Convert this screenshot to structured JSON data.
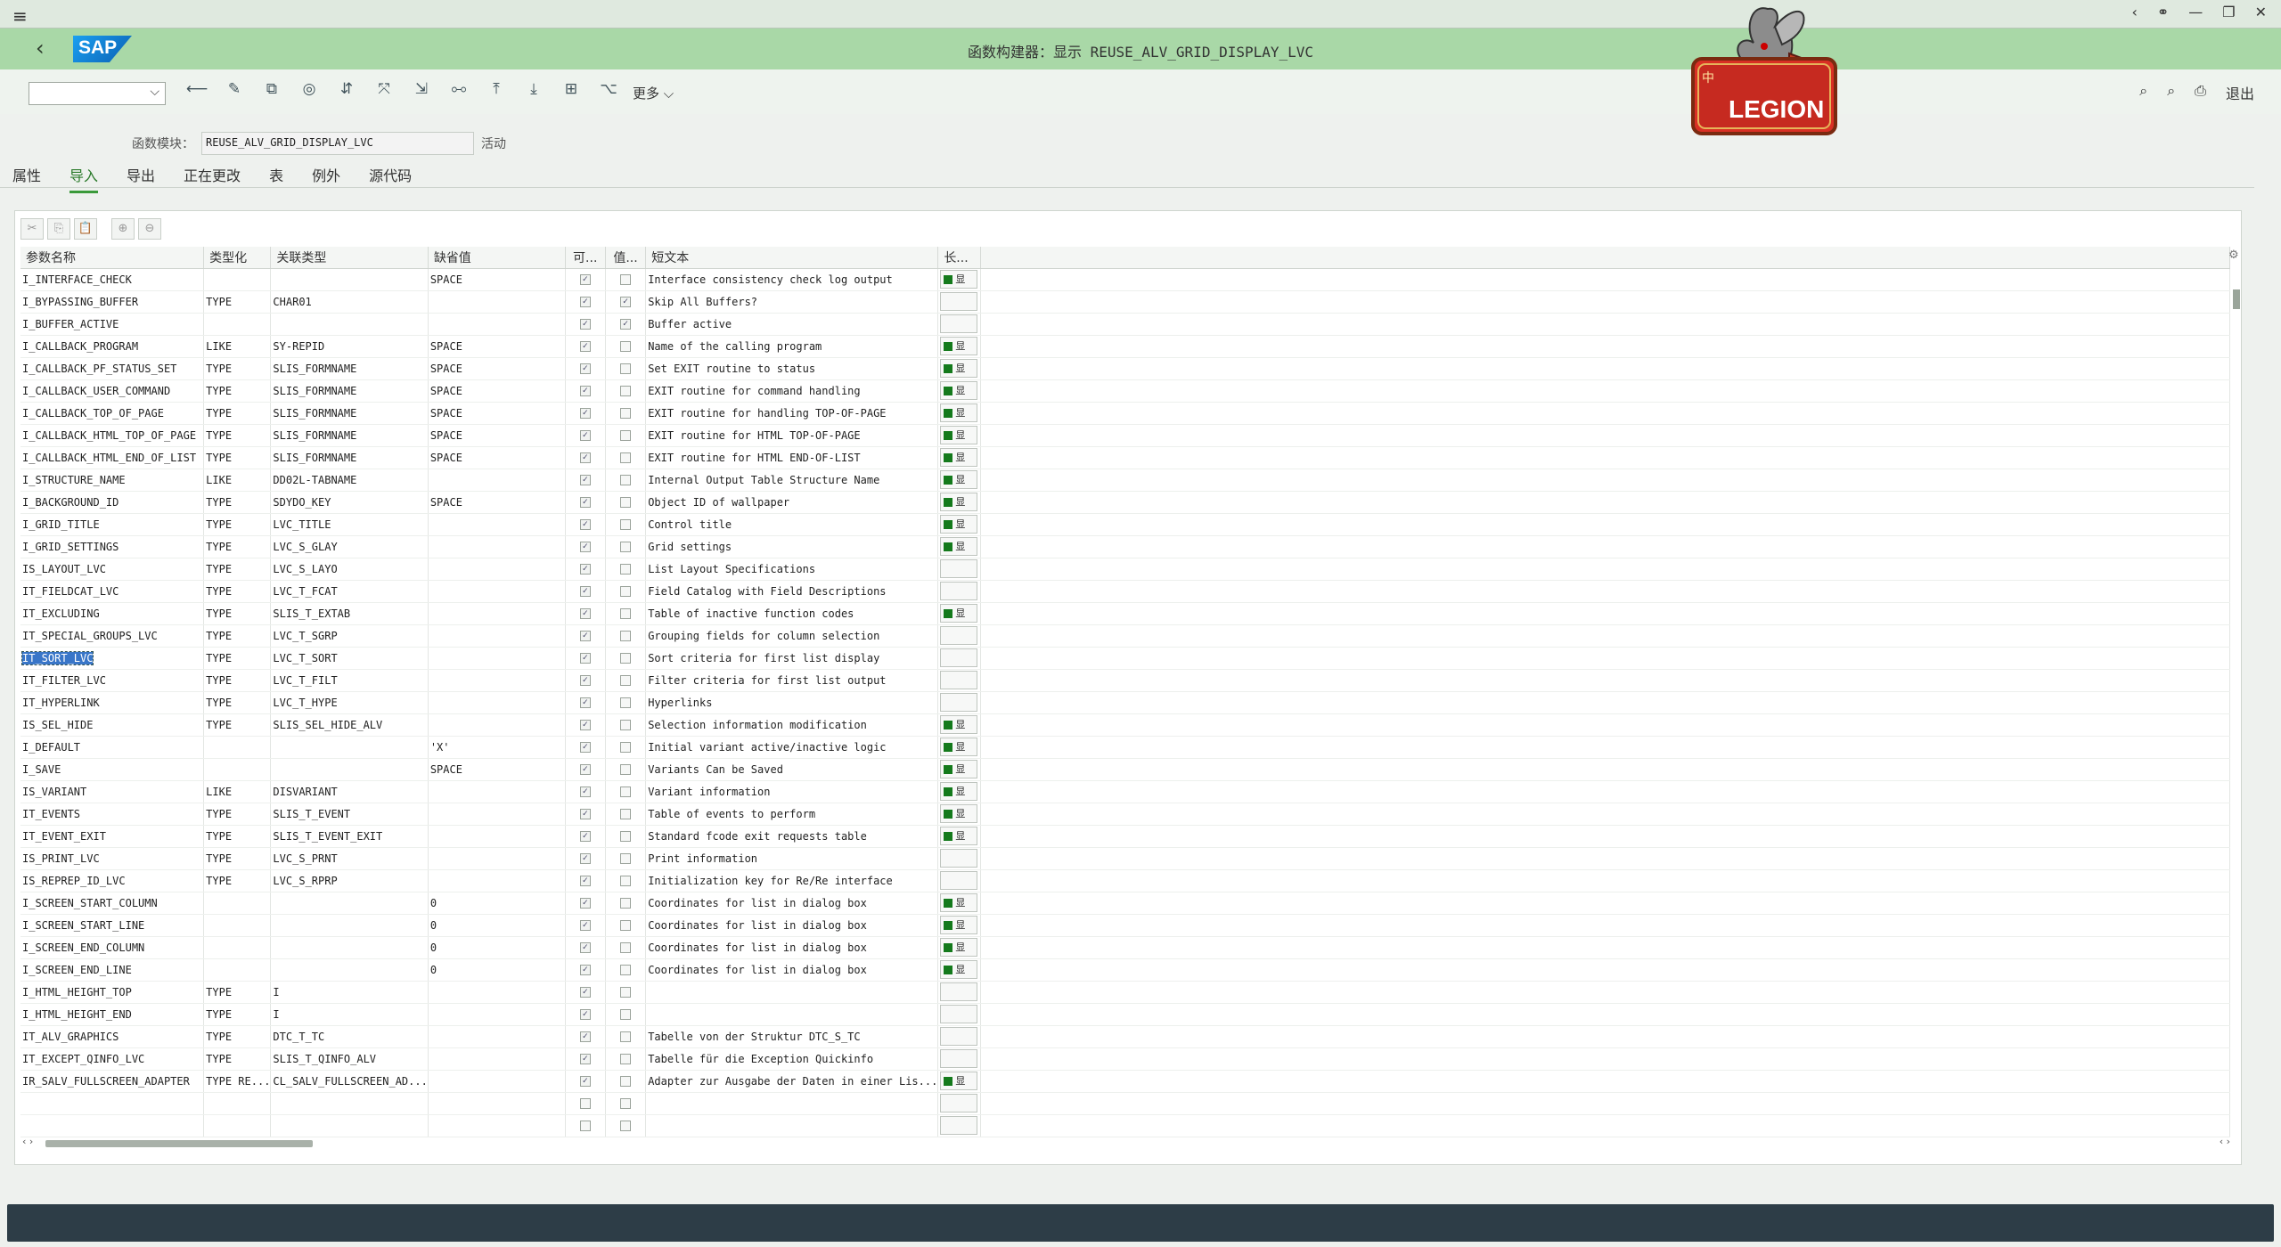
{
  "window": {
    "title": "函数构建器：显示 REUSE_ALV_GRID_DISPLAY_LVC",
    "logo": "SAP"
  },
  "toolbar": {
    "more": "更多",
    "exit": "退出",
    "brand": "LEGION",
    "brand_badge": "中"
  },
  "module": {
    "label": "函数模块：",
    "value": "REUSE_ALV_GRID_DISPLAY_LVC",
    "status": "活动"
  },
  "tabs": [
    {
      "label": "属性",
      "active": false
    },
    {
      "label": "导入",
      "active": true
    },
    {
      "label": "导出",
      "active": false
    },
    {
      "label": "正在更改",
      "active": false
    },
    {
      "label": "表",
      "active": false
    },
    {
      "label": "例外",
      "active": false
    },
    {
      "label": "源代码",
      "active": false
    }
  ],
  "columns": [
    "参数名称",
    "类型化",
    "关联类型",
    "缺省值",
    "可...",
    "值...",
    "短文本",
    "长..."
  ],
  "long_label": "显",
  "rows": [
    [
      "I_INTERFACE_CHECK",
      "",
      "",
      "SPACE",
      true,
      false,
      "Interface consistency check log output",
      true
    ],
    [
      "I_BYPASSING_BUFFER",
      "TYPE",
      "CHAR01",
      "",
      true,
      true,
      "Skip All Buffers?",
      false
    ],
    [
      "I_BUFFER_ACTIVE",
      "",
      "",
      "",
      true,
      true,
      "Buffer active",
      false
    ],
    [
      "I_CALLBACK_PROGRAM",
      "LIKE",
      "SY-REPID",
      "SPACE",
      true,
      false,
      "Name of the calling program",
      true
    ],
    [
      "I_CALLBACK_PF_STATUS_SET",
      "TYPE",
      "SLIS_FORMNAME",
      "SPACE",
      true,
      false,
      "Set EXIT routine to status",
      true
    ],
    [
      "I_CALLBACK_USER_COMMAND",
      "TYPE",
      "SLIS_FORMNAME",
      "SPACE",
      true,
      false,
      "EXIT routine for command handling",
      true
    ],
    [
      "I_CALLBACK_TOP_OF_PAGE",
      "TYPE",
      "SLIS_FORMNAME",
      "SPACE",
      true,
      false,
      "EXIT routine for handling TOP-OF-PAGE",
      true
    ],
    [
      "I_CALLBACK_HTML_TOP_OF_PAGE",
      "TYPE",
      "SLIS_FORMNAME",
      "SPACE",
      true,
      false,
      "EXIT routine for HTML TOP-OF-PAGE",
      true
    ],
    [
      "I_CALLBACK_HTML_END_OF_LIST",
      "TYPE",
      "SLIS_FORMNAME",
      "SPACE",
      true,
      false,
      "EXIT routine for HTML END-OF-LIST",
      true
    ],
    [
      "I_STRUCTURE_NAME",
      "LIKE",
      "DD02L-TABNAME",
      "",
      true,
      false,
      "Internal Output Table Structure Name",
      true
    ],
    [
      "I_BACKGROUND_ID",
      "TYPE",
      "SDYDO_KEY",
      "SPACE",
      true,
      false,
      "Object ID of wallpaper",
      true
    ],
    [
      "I_GRID_TITLE",
      "TYPE",
      "LVC_TITLE",
      "",
      true,
      false,
      "Control title",
      true
    ],
    [
      "I_GRID_SETTINGS",
      "TYPE",
      "LVC_S_GLAY",
      "",
      true,
      false,
      "Grid settings",
      true
    ],
    [
      "IS_LAYOUT_LVC",
      "TYPE",
      "LVC_S_LAYO",
      "",
      true,
      false,
      "List Layout Specifications",
      false
    ],
    [
      "IT_FIELDCAT_LVC",
      "TYPE",
      "LVC_T_FCAT",
      "",
      true,
      false,
      "Field Catalog with Field Descriptions",
      false
    ],
    [
      "IT_EXCLUDING",
      "TYPE",
      "SLIS_T_EXTAB",
      "",
      true,
      false,
      "Table of inactive function codes",
      true
    ],
    [
      "IT_SPECIAL_GROUPS_LVC",
      "TYPE",
      "LVC_T_SGRP",
      "",
      true,
      false,
      "Grouping fields for column selection",
      false
    ],
    [
      "IT_SORT_LVC",
      "TYPE",
      "LVC_T_SORT",
      "",
      true,
      false,
      "Sort criteria for first list display",
      false
    ],
    [
      "IT_FILTER_LVC",
      "TYPE",
      "LVC_T_FILT",
      "",
      true,
      false,
      "Filter criteria for first list output",
      false
    ],
    [
      "IT_HYPERLINK",
      "TYPE",
      "LVC_T_HYPE",
      "",
      true,
      false,
      "Hyperlinks",
      false
    ],
    [
      "IS_SEL_HIDE",
      "TYPE",
      "SLIS_SEL_HIDE_ALV",
      "",
      true,
      false,
      "Selection information modification",
      true
    ],
    [
      "I_DEFAULT",
      "",
      "",
      "'X'",
      true,
      false,
      "Initial variant active/inactive logic",
      true
    ],
    [
      "I_SAVE",
      "",
      "",
      "SPACE",
      true,
      false,
      "Variants Can be Saved",
      true
    ],
    [
      "IS_VARIANT",
      "LIKE",
      "DISVARIANT",
      "",
      true,
      false,
      "Variant information",
      true
    ],
    [
      "IT_EVENTS",
      "TYPE",
      "SLIS_T_EVENT",
      "",
      true,
      false,
      "Table of events to perform",
      true
    ],
    [
      "IT_EVENT_EXIT",
      "TYPE",
      "SLIS_T_EVENT_EXIT",
      "",
      true,
      false,
      "Standard fcode exit requests table",
      true
    ],
    [
      "IS_PRINT_LVC",
      "TYPE",
      "LVC_S_PRNT",
      "",
      true,
      false,
      "Print information",
      false
    ],
    [
      "IS_REPREP_ID_LVC",
      "TYPE",
      "LVC_S_RPRP",
      "",
      true,
      false,
      "Initialization key for Re/Re interface",
      false
    ],
    [
      "I_SCREEN_START_COLUMN",
      "",
      "",
      "0",
      true,
      false,
      "Coordinates for list in dialog box",
      true
    ],
    [
      "I_SCREEN_START_LINE",
      "",
      "",
      "0",
      true,
      false,
      "Coordinates for list in dialog box",
      true
    ],
    [
      "I_SCREEN_END_COLUMN",
      "",
      "",
      "0",
      true,
      false,
      "Coordinates for list in dialog box",
      true
    ],
    [
      "I_SCREEN_END_LINE",
      "",
      "",
      "0",
      true,
      false,
      "Coordinates for list in dialog box",
      true
    ],
    [
      "I_HTML_HEIGHT_TOP",
      "TYPE",
      "I",
      "",
      true,
      false,
      "",
      false
    ],
    [
      "I_HTML_HEIGHT_END",
      "TYPE",
      "I",
      "",
      true,
      false,
      "",
      false
    ],
    [
      "IT_ALV_GRAPHICS",
      "TYPE",
      "DTC_T_TC",
      "",
      true,
      false,
      "Tabelle von der Struktur DTC_S_TC",
      false
    ],
    [
      "IT_EXCEPT_QINFO_LVC",
      "TYPE",
      "SLIS_T_QINFO_ALV",
      "",
      true,
      false,
      "Tabelle für die Exception Quickinfo",
      false
    ],
    [
      "IR_SALV_FULLSCREEN_ADAPTER",
      "TYPE RE...",
      "CL_SALV_FULLSCREEN_AD...",
      "",
      true,
      false,
      "Adapter zur Ausgabe der Daten in einer Lis...",
      true
    ],
    [
      "",
      "",
      "",
      "",
      false,
      false,
      "",
      false
    ],
    [
      "",
      "",
      "",
      "",
      false,
      false,
      "",
      false
    ]
  ],
  "selected_row": 17,
  "colors": {
    "title_bar": "#a9d8a7",
    "status_bar": "#2d3d47",
    "selection": "#3976c8",
    "long_text_marker": "#147a1c"
  }
}
